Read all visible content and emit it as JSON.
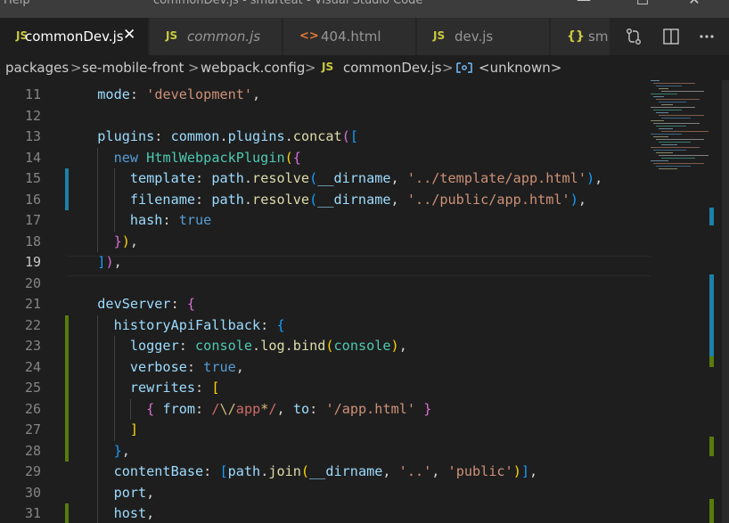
{
  "window": {
    "menu_label": "Help",
    "title": "commonDev.js - smarteat - Visual Studio Code",
    "controls": {
      "minimize": "—",
      "maximize": "☐",
      "close": "✕"
    }
  },
  "tabs": [
    {
      "icon": "JS",
      "label": "commonDev.js",
      "close": "✕",
      "active": true,
      "italic": false
    },
    {
      "icon": "JS",
      "label": "common.js",
      "active": false,
      "italic": true
    },
    {
      "icon": "<>",
      "label": "404.html",
      "active": false,
      "italic": false
    },
    {
      "icon": "JS",
      "label": "dev.js",
      "active": false,
      "italic": false
    },
    {
      "icon": "{}",
      "label": "sm",
      "active": false,
      "italic": false
    }
  ],
  "breadcrumb": {
    "items": [
      "packages",
      "se-mobile-front",
      "webpack.config",
      "commonDev.js",
      "<unknown>"
    ],
    "separator": ">",
    "file_icon": "JS"
  },
  "editor": {
    "line_numbers": [
      "11",
      "12",
      "13",
      "14",
      "15",
      "16",
      "17",
      "18",
      "19",
      "20",
      "21",
      "22",
      "23",
      "24",
      "25",
      "26",
      "27",
      "28",
      "29",
      "30",
      "31"
    ],
    "current_line": "19",
    "lines": [
      [
        {
          "t": "  mode",
          "c": "p"
        },
        {
          "t": ": "
        },
        {
          "t": "'development'",
          "c": "s"
        },
        {
          "t": ","
        }
      ],
      [],
      [
        {
          "t": "  plugins",
          "c": "p"
        },
        {
          "t": ": "
        },
        {
          "t": "common",
          "c": "p"
        },
        {
          "t": "."
        },
        {
          "t": "plugins",
          "c": "p"
        },
        {
          "t": "."
        },
        {
          "t": "concat",
          "c": "f"
        },
        {
          "t": "(",
          "c": "b2"
        },
        {
          "t": "[",
          "c": "b3"
        }
      ],
      [
        {
          "t": "    "
        },
        {
          "t": "new",
          "c": "k"
        },
        {
          "t": " "
        },
        {
          "t": "HtmlWebpackPlugin",
          "c": "c"
        },
        {
          "t": "(",
          "c": "b1"
        },
        {
          "t": "{",
          "c": "b2"
        }
      ],
      [
        {
          "t": "      template",
          "c": "p"
        },
        {
          "t": ": "
        },
        {
          "t": "path",
          "c": "p"
        },
        {
          "t": "."
        },
        {
          "t": "resolve",
          "c": "f"
        },
        {
          "t": "(",
          "c": "b3"
        },
        {
          "t": "__dirname",
          "c": "p"
        },
        {
          "t": ", "
        },
        {
          "t": "'../template/app.html'",
          "c": "s"
        },
        {
          "t": ")",
          "c": "b3"
        },
        {
          "t": ","
        }
      ],
      [
        {
          "t": "      filename",
          "c": "p"
        },
        {
          "t": ": "
        },
        {
          "t": "path",
          "c": "p"
        },
        {
          "t": "."
        },
        {
          "t": "resolve",
          "c": "f"
        },
        {
          "t": "(",
          "c": "b3"
        },
        {
          "t": "__dirname",
          "c": "p"
        },
        {
          "t": ", "
        },
        {
          "t": "'../public/app.html'",
          "c": "s"
        },
        {
          "t": ")",
          "c": "b3"
        },
        {
          "t": ","
        }
      ],
      [
        {
          "t": "      hash",
          "c": "p"
        },
        {
          "t": ": "
        },
        {
          "t": "true",
          "c": "k"
        }
      ],
      [
        {
          "t": "    "
        },
        {
          "t": "}",
          "c": "b2"
        },
        {
          "t": ")",
          "c": "b1"
        },
        {
          "t": ","
        }
      ],
      [
        {
          "t": "  "
        },
        {
          "t": "]",
          "c": "b3"
        },
        {
          "t": ")",
          "c": "b2"
        },
        {
          "t": ","
        }
      ],
      [],
      [
        {
          "t": "  devServer",
          "c": "p"
        },
        {
          "t": ": "
        },
        {
          "t": "{",
          "c": "b2"
        }
      ],
      [
        {
          "t": "    historyApiFallback",
          "c": "p"
        },
        {
          "t": ": "
        },
        {
          "t": "{",
          "c": "b3"
        }
      ],
      [
        {
          "t": "      logger",
          "c": "p"
        },
        {
          "t": ": "
        },
        {
          "t": "console",
          "c": "c"
        },
        {
          "t": "."
        },
        {
          "t": "log",
          "c": "f"
        },
        {
          "t": "."
        },
        {
          "t": "bind",
          "c": "f"
        },
        {
          "t": "(",
          "c": "b1"
        },
        {
          "t": "console",
          "c": "c"
        },
        {
          "t": ")",
          "c": "b1"
        },
        {
          "t": ","
        }
      ],
      [
        {
          "t": "      verbose",
          "c": "p"
        },
        {
          "t": ": "
        },
        {
          "t": "true",
          "c": "k"
        },
        {
          "t": ","
        }
      ],
      [
        {
          "t": "      rewrites",
          "c": "p"
        },
        {
          "t": ": "
        },
        {
          "t": "[",
          "c": "b1"
        }
      ],
      [
        {
          "t": "        "
        },
        {
          "t": "{",
          "c": "b2"
        },
        {
          "t": " "
        },
        {
          "t": "from",
          "c": "p"
        },
        {
          "t": ": "
        },
        {
          "t": "/",
          "c": "r"
        },
        {
          "t": "\\/",
          "c": "rx"
        },
        {
          "t": "app",
          "c": "r"
        },
        {
          "t": "*",
          "c": "rx"
        },
        {
          "t": "/",
          "c": "r"
        },
        {
          "t": ", "
        },
        {
          "t": "to",
          "c": "p"
        },
        {
          "t": ": "
        },
        {
          "t": "'/app.html'",
          "c": "s"
        },
        {
          "t": " "
        },
        {
          "t": "}",
          "c": "b2"
        }
      ],
      [
        {
          "t": "      "
        },
        {
          "t": "]",
          "c": "b1"
        }
      ],
      [
        {
          "t": "    "
        },
        {
          "t": "}",
          "c": "b3"
        },
        {
          "t": ","
        }
      ],
      [
        {
          "t": "    contentBase",
          "c": "p"
        },
        {
          "t": ": "
        },
        {
          "t": "[",
          "c": "b3"
        },
        {
          "t": "path",
          "c": "p"
        },
        {
          "t": "."
        },
        {
          "t": "join",
          "c": "f"
        },
        {
          "t": "(",
          "c": "b1"
        },
        {
          "t": "__dirname",
          "c": "p"
        },
        {
          "t": ", "
        },
        {
          "t": "'..'",
          "c": "s"
        },
        {
          "t": ", "
        },
        {
          "t": "'public'",
          "c": "s"
        },
        {
          "t": ")",
          "c": "b1"
        },
        {
          "t": "]",
          "c": "b3"
        },
        {
          "t": ","
        }
      ],
      [
        {
          "t": "    port",
          "c": "p"
        },
        {
          "t": ","
        }
      ],
      [
        {
          "t": "    host",
          "c": "p"
        },
        {
          "t": ","
        }
      ]
    ],
    "gutter_marks": [
      {
        "line": "15",
        "type": "modified"
      },
      {
        "line": "16",
        "type": "modified"
      },
      {
        "line": "22",
        "type": "added"
      },
      {
        "line": "23",
        "type": "added"
      },
      {
        "line": "24",
        "type": "added"
      },
      {
        "line": "25",
        "type": "added"
      },
      {
        "line": "26",
        "type": "added"
      },
      {
        "line": "27",
        "type": "added"
      },
      {
        "line": "28",
        "type": "added"
      },
      {
        "line": "31",
        "type": "added"
      }
    ]
  },
  "colors": {
    "editor_bg": "#1e1e1e",
    "tab_inactive_bg": "#2d2d2d",
    "modified_marker": "#1b81a8",
    "added_marker": "#587c0c",
    "keyword": "#569cd6",
    "property": "#9cdcfe",
    "string": "#ce9178",
    "function": "#dcdcaa",
    "class": "#4ec9b0"
  }
}
